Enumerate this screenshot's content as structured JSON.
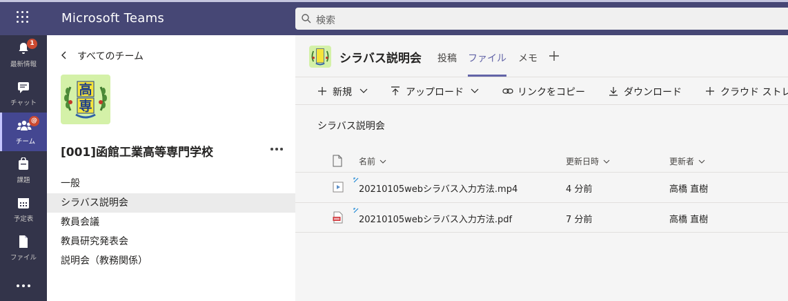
{
  "app": {
    "title": "Microsoft Teams"
  },
  "search": {
    "placeholder": "検索"
  },
  "rail": {
    "items": [
      {
        "label": "最新情報",
        "icon": "bell-icon",
        "badge": "1"
      },
      {
        "label": "チャット",
        "icon": "chat-icon"
      },
      {
        "label": "チーム",
        "icon": "teams-icon",
        "badge": "@",
        "active": true
      },
      {
        "label": "課題",
        "icon": "assignments-icon"
      },
      {
        "label": "予定表",
        "icon": "calendar-icon"
      },
      {
        "label": "ファイル",
        "icon": "file-icon"
      }
    ]
  },
  "team_panel": {
    "back_label": "すべてのチーム",
    "logo_text": "高専",
    "team_name": "[001]函館工業高等専門学校",
    "channels": [
      {
        "label": "一般"
      },
      {
        "label": "シラバス説明会",
        "selected": true
      },
      {
        "label": "教員会議"
      },
      {
        "label": "教員研究発表会"
      },
      {
        "label": "説明会（教務関係）"
      }
    ]
  },
  "main": {
    "channel_title": "シラバス説明会",
    "tabs": [
      {
        "label": "投稿"
      },
      {
        "label": "ファイル",
        "active": true
      },
      {
        "label": "メモ"
      }
    ],
    "toolbar": {
      "new_label": "新規",
      "upload_label": "アップロード",
      "copy_link_label": "リンクをコピー",
      "download_label": "ダウンロード",
      "cloud_label": "クラウド ストレ"
    },
    "breadcrumb": "シラバス説明会",
    "table": {
      "headers": {
        "name": "名前",
        "modified": "更新日時",
        "modified_by": "更新者"
      },
      "rows": [
        {
          "name": "20210105webシラバス入力方法.mp4",
          "modified": "4 分前",
          "modified_by": "高橋 直樹",
          "type": "video"
        },
        {
          "name": "20210105webシラバス入力方法.pdf",
          "modified": "7 分前",
          "modified_by": "高橋 直樹",
          "type": "pdf"
        }
      ]
    }
  },
  "colors": {
    "top_bar": "#464775",
    "rail": "#33344a",
    "accent": "#6264a7",
    "badge": "#cc4a31"
  }
}
